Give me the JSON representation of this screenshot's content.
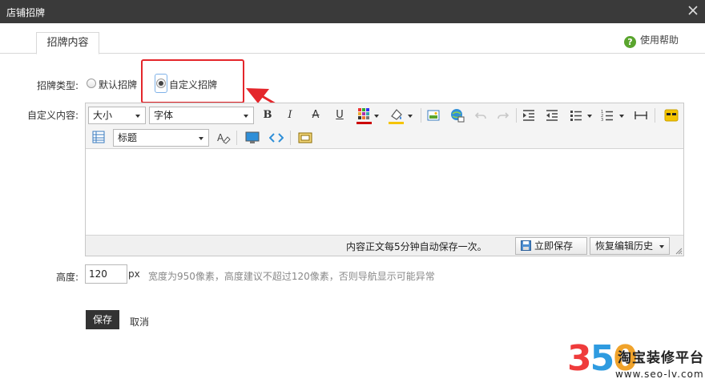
{
  "dialog": {
    "title": "店铺招牌",
    "close_icon": "close-icon"
  },
  "tabs": [
    {
      "label": "招牌内容"
    }
  ],
  "help": {
    "icon": "help-circle-icon",
    "label": "使用帮助"
  },
  "form": {
    "type_label": "招牌类型:",
    "type_options": [
      {
        "label": "默认招牌",
        "checked": false
      },
      {
        "label": "自定义招牌",
        "checked": true
      }
    ],
    "content_label": "自定义内容:",
    "height_label": "高度:",
    "height_value": "120",
    "height_unit": "px",
    "height_hint": "宽度为950像素，高度建议不超过120像素，否则导航显示可能异常"
  },
  "editor": {
    "size_select": "大小",
    "font_select": "字体",
    "heading_select": "标题",
    "buttons": {
      "bold": "B",
      "italic": "I",
      "strike": "A",
      "underline": "U"
    },
    "icons": [
      "text-color-icon",
      "highlight-color-icon",
      "insert-image-icon",
      "insert-link-icon",
      "undo-icon",
      "redo-icon",
      "indent-icon",
      "outdent-icon",
      "bullet-list-icon",
      "numbered-list-icon",
      "horizontal-rule-icon",
      "emoticon-icon",
      "table-icon",
      "clear-format-icon",
      "media-icon",
      "source-code-icon",
      "fullscreen-icon"
    ],
    "autosave_text": "内容正文每5分钟自动保存一次。",
    "save_now_label": "立即保存",
    "restore_label": "恢复编辑历史"
  },
  "actions": {
    "save": "保存",
    "cancel": "取消"
  },
  "annotation": {
    "color": "#e4262b"
  },
  "watermark": {
    "digits": [
      "3",
      "5",
      "0"
    ],
    "brand": "淘宝装修平台",
    "url": "www.seo-lv.com"
  }
}
